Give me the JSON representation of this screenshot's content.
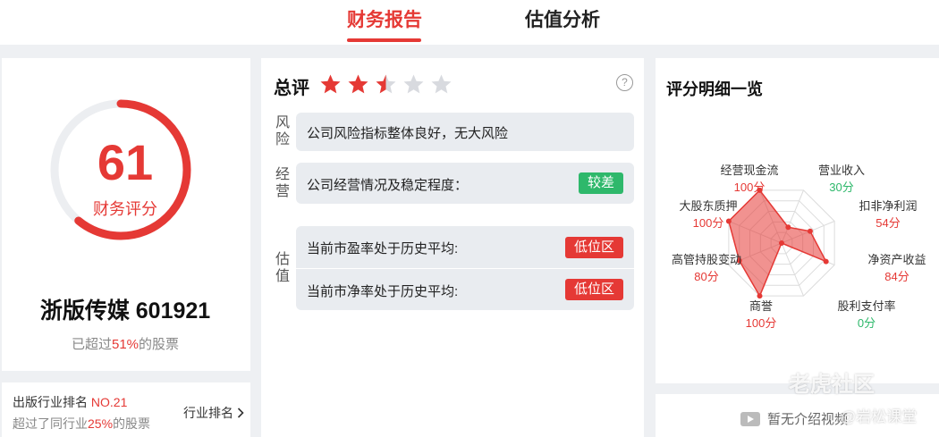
{
  "tabs": [
    {
      "label": "财务报告",
      "active": true
    },
    {
      "label": "估值分析",
      "active": false
    }
  ],
  "score": {
    "value": "61",
    "fraction": 0.61,
    "label": "财务评分",
    "company": "浙版传媒 601921",
    "surpass_prefix": "已超过",
    "surpass_pct": "51%",
    "surpass_suffix": "的股票"
  },
  "industry_rank": {
    "prefix": "出版行业排名 ",
    "rank": "NO.21",
    "line2_prefix": "超过了同行业",
    "line2_pct": "25%",
    "line2_suffix": "的股票",
    "link_label": "行业排名",
    "link_icon": "chevron-right-icon"
  },
  "overall": {
    "title": "总评",
    "stars": 2.5,
    "max_stars": 5,
    "help_icon": "question-circle-icon",
    "help_glyph": "?"
  },
  "sections": {
    "risk": {
      "label": "风险",
      "text": "公司风险指标整体良好，无大风险"
    },
    "operation": {
      "label": "经营",
      "text": "公司经营情况及稳定程度：",
      "badge": "较差"
    },
    "valuation": {
      "label": "估值",
      "rows": [
        {
          "text": "当前市盈率处于历史平均:",
          "badge": "低位区"
        },
        {
          "text": "当前市净率处于历史平均:",
          "badge": "低位区"
        }
      ]
    }
  },
  "detail": {
    "title": "评分明细一览",
    "radar": [
      {
        "name": "营业收入",
        "score": "30分",
        "value": 30,
        "color": "#2eb86b"
      },
      {
        "name": "扣非净利润",
        "score": "54分",
        "value": 54,
        "color": "#e53935"
      },
      {
        "name": "净资产收益",
        "score": "84分",
        "value": 84,
        "color": "#e53935"
      },
      {
        "name": "股利支付率",
        "score": "0分",
        "value": 0,
        "color": "#2eb86b"
      },
      {
        "name": "商誉",
        "score": "100分",
        "value": 100,
        "color": "#e53935"
      },
      {
        "name": "高管持股变动",
        "score": "80分",
        "value": 80,
        "color": "#e53935"
      },
      {
        "name": "大股东质押",
        "score": "100分",
        "value": 100,
        "color": "#e53935"
      },
      {
        "name": "经营现金流",
        "score": "100分",
        "value": 100,
        "color": "#e53935"
      }
    ]
  },
  "video": {
    "label": "暂无介绍视频",
    "icon": "play-icon"
  },
  "watermark": {
    "main": "老虎社区",
    "sub": "@岩松课堂"
  },
  "colors": {
    "accent": "#e53935",
    "positive": "#2eb86b"
  }
}
